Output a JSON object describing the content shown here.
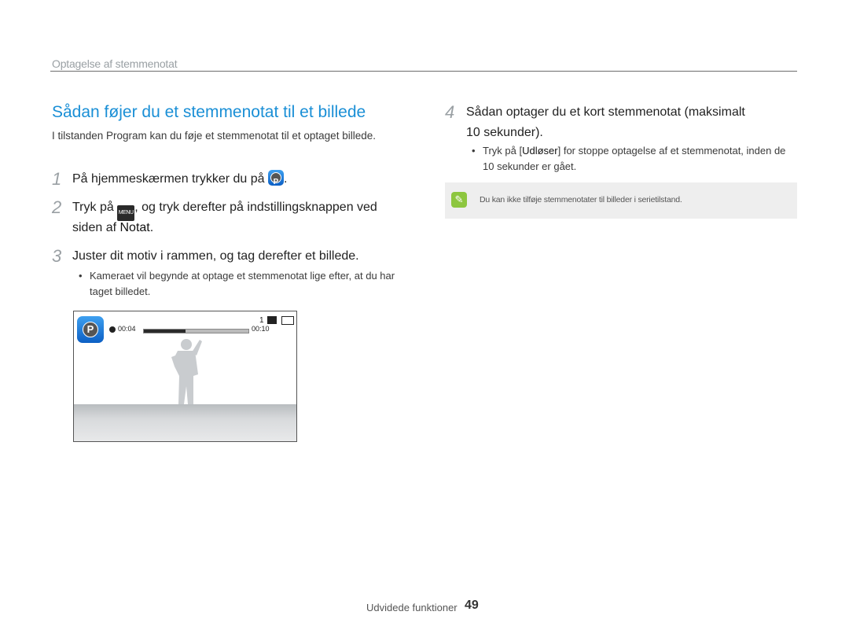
{
  "header": {
    "section_label": "Optagelse af stemmenotat"
  },
  "title": "Sådan føjer du et stemmenotat til et billede",
  "intro": "I tilstanden Program kan du føje et stemmenotat til et optaget billede.",
  "steps": [
    {
      "num": "1",
      "text_before": "På hjemmeskærmen trykker du på",
      "text_after": "."
    },
    {
      "num": "2",
      "line1_before": "Tryk på",
      "line1_after": ", og tryk derefter på indstillingsknappen ved",
      "line2_before": "siden af ",
      "line2_kw": "Notat",
      "line2_after": "."
    },
    {
      "num": "3",
      "text": "Juster dit motiv i rammen, og tag derefter et billede.",
      "bullet": "Kameraet vil begynde at optage et stemmenotat lige efter, at du har taget billedet."
    },
    {
      "num": "4",
      "line1": "Sådan optager du et kort stemmenotat (maksimalt",
      "line2": "10 sekunder).",
      "bullet_before": "Tryk på [",
      "bullet_kw": "Udløser",
      "bullet_after": "] for stoppe optagelse af et stemmenotat, inden de 10 sekunder er gået."
    }
  ],
  "icons": {
    "program_icon": "P",
    "menu_icon": "MENU"
  },
  "camera_screen": {
    "mode_icon": "P",
    "shot_count": "1",
    "elapsed": "00:04",
    "total": "00:10",
    "progress": 0.4
  },
  "note": {
    "icon": "note-icon",
    "text": "Du kan ikke tilføje stemmenotater til billeder i serietilstand."
  },
  "footer": {
    "label": "Udvidede funktioner",
    "page": "49"
  },
  "colors": {
    "title": "#1a8fd6",
    "note_icon": "#8dc63f"
  }
}
